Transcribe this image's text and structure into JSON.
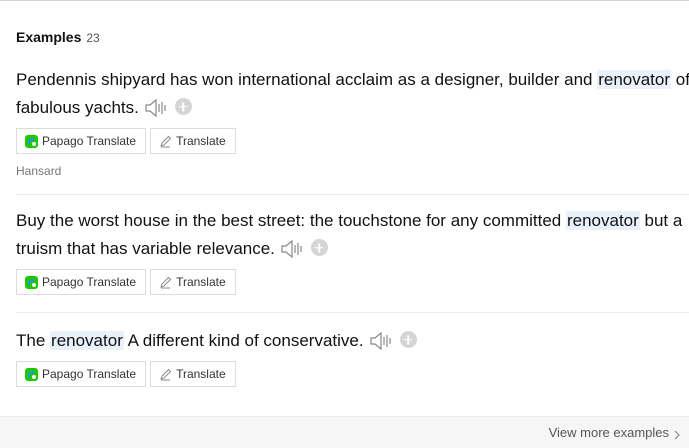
{
  "header": {
    "title": "Examples",
    "count": "23"
  },
  "examples": [
    {
      "before": "Pendennis shipyard has won international acclaim as a designer, builder and ",
      "highlight": "renovator",
      "after": " of fabulous yachts.",
      "papago_label": "Papago Translate",
      "translate_label": "Translate",
      "source": "Hansard"
    },
    {
      "before": "Buy the worst house in the best street: the touchstone for any committed ",
      "highlight": "renovator",
      "after": " but a truism that has variable relevance.",
      "papago_label": "Papago Translate",
      "translate_label": "Translate"
    },
    {
      "before": "The ",
      "highlight": "renovator",
      "after": " A different kind of conservative.",
      "papago_label": "Papago Translate",
      "translate_label": "Translate"
    }
  ],
  "footer": {
    "view_more_label": "View more examples"
  },
  "colors": {
    "highlight": "#e9f2fb",
    "papago_green": "#1ec800",
    "papago_blue": "#2d8cff"
  },
  "icons": [
    "speaker-icon",
    "add-icon",
    "papago-icon",
    "pen-icon",
    "chevron-right-icon"
  ]
}
